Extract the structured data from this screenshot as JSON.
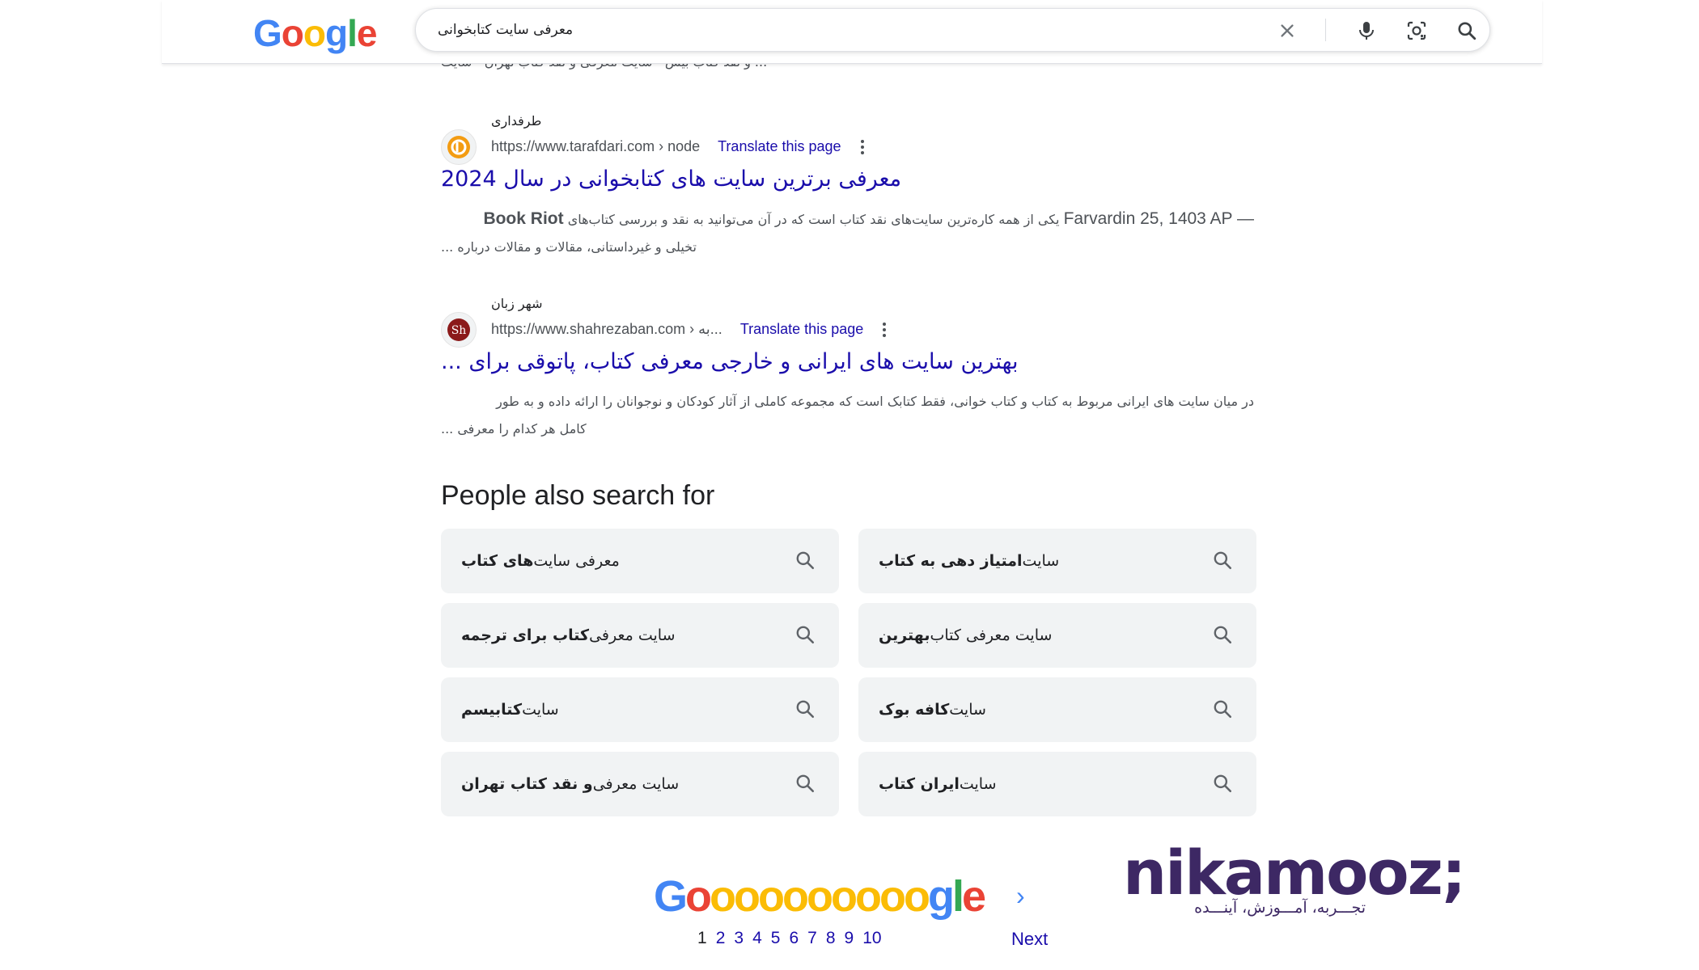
{
  "logo": {
    "letters": [
      "G",
      "o",
      "o",
      "g",
      "l",
      "e"
    ],
    "colors": [
      "#4285f4",
      "#ea4335",
      "#fbbc05",
      "#4285f4",
      "#34a853",
      "#ea4335"
    ]
  },
  "search": {
    "query": "معرفی سایت کتابخوانی"
  },
  "icons": {
    "clear": "close-icon",
    "voice": "microphone-icon",
    "lens": "camera-lens-icon",
    "search": "search-icon"
  },
  "cut_line": "... و نقد کتاب بیس · سایت معرفی و نقد کتاب تهران · سایت",
  "results": [
    {
      "site_name": "طرفداری",
      "url": "https://www.tarafdari.com › node",
      "translate": "Translate this page",
      "title": "معرفی برترین سایت های کتابخوانی در سال 2024",
      "snippet_bold": "Book Riot",
      "snippet_line1": "یکی از همه کاره‌ترین سایت‌های نقد کتاب است که در آن می‌توانید به نقد و بررسی کتاب‌های",
      "snippet_date": "Farvardin 25, 1403 AP —",
      "snippet_line2": "تخیلی و غیرداستانی، مقالات و مقالات درباره ...",
      "favicon_color": "#f39c12"
    },
    {
      "site_name": "شهر زبان",
      "url": "https://www.shahrezaban.com › به...",
      "translate": "Translate this page",
      "title": "بهترین سایت های ایرانی و خارجی معرفی کتاب، پاتوقی برای ...",
      "snippet_line1": "در میان سایت های ایرانی مربوط به کتاب و کتاب خوانی، فقط کتابک است که مجموعه کاملی از آثار کودکان و نوجوانان را ارائه داده و به طور",
      "snippet_line2": "کامل هر کدام را معرفی ...",
      "favicon_color": "#8b1a1a"
    }
  ],
  "people_also_search": {
    "title": "People also search for",
    "items": [
      {
        "plain": "معرفی سایت",
        "bold": "های کتاب"
      },
      {
        "plain": "سایت",
        "bold": "امتیاز دهی به کتاب"
      },
      {
        "plain": "سایت معرفی",
        "bold": "کتاب برای ترجمه"
      },
      {
        "plain": "سایت معرفی کتاب",
        "bold": "بهترین"
      },
      {
        "plain": "سایت",
        "bold": "کتابیسم"
      },
      {
        "plain": "سایت",
        "bold": "کافه بوک"
      },
      {
        "plain": "سایت معرفی",
        "bold": "و نقد کتاب تهران"
      },
      {
        "plain": "سایت",
        "bold": "ایران کتاب"
      }
    ]
  },
  "pagination": {
    "pages": [
      "1",
      "2",
      "3",
      "4",
      "5",
      "6",
      "7",
      "8",
      "9",
      "10"
    ],
    "current": "1",
    "next": "Next",
    "goo_text": "Goooooooooogle"
  },
  "brand": {
    "name": "nikamooz;",
    "tagline": "تجـــربه، آمـــوزش، آینـــده",
    "color": "#3d2864"
  }
}
